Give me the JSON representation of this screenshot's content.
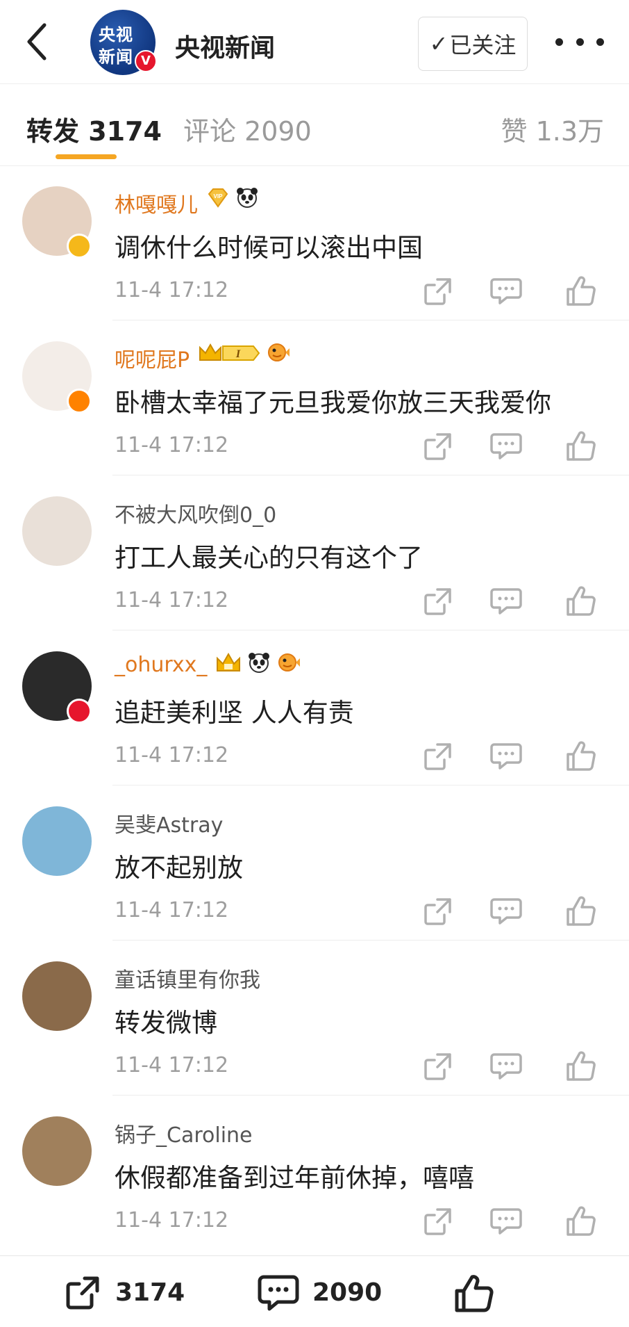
{
  "header": {
    "logo_text_line1": "央视",
    "logo_text_line2": "新闻",
    "logo_verified": "V",
    "account_name": "央视新闻",
    "follow_label": "已关注",
    "follow_check": "✓"
  },
  "tabs": {
    "repost": "转发 3174",
    "comments": "评论 2090",
    "likes": "赞 1.3万",
    "accent_color": "#f5a623"
  },
  "reposts": [
    {
      "username": "林嘎嘎儿",
      "vip": true,
      "badges": [
        "vip-diamond-icon",
        "panda-icon"
      ],
      "text": "调休什么时候可以滚出中国",
      "time": "11-4 17:12",
      "avatar_color": "#e6d2c2",
      "verified": "yellow"
    },
    {
      "username": "呢呢屁P",
      "vip": true,
      "badges": [
        "crown-level-icon",
        "pufferfish-icon"
      ],
      "level": "I",
      "text": "卧槽太幸福了元旦我爱你放三天我爱你",
      "time": "11-4 17:12",
      "avatar_color": "#f3ede8",
      "verified": "orange"
    },
    {
      "username": "不被大风吹倒0_0",
      "vip": false,
      "badges": [],
      "text": "打工人最关心的只有这个了",
      "time": "11-4 17:12",
      "avatar_color": "#e9e0d8",
      "verified": ""
    },
    {
      "username": "_ohurxx_",
      "vip": true,
      "badges": [
        "crown-icon",
        "panda-icon",
        "pufferfish-icon"
      ],
      "text": "追赶美利坚 人人有责",
      "time": "11-4 17:12",
      "avatar_color": "#2a2a2a",
      "verified": "red"
    },
    {
      "username": "吴斐Astray",
      "vip": false,
      "badges": [],
      "text": "放不起别放",
      "time": "11-4 17:12",
      "avatar_color": "#7fb6d8",
      "verified": ""
    },
    {
      "username": "童话镇里有你我",
      "vip": false,
      "badges": [],
      "text": "转发微博",
      "time": "11-4 17:12",
      "avatar_color": "#8a6a4a",
      "verified": ""
    },
    {
      "username": "锅子_Caroline",
      "vip": false,
      "badges": [],
      "text": "休假都准备到过年前休掉，嘻嘻",
      "time": "11-4 17:12",
      "avatar_color": "#a0805c",
      "verified": ""
    }
  ],
  "bottom_bar": {
    "repost_count": "3174",
    "comment_count": "2090"
  }
}
